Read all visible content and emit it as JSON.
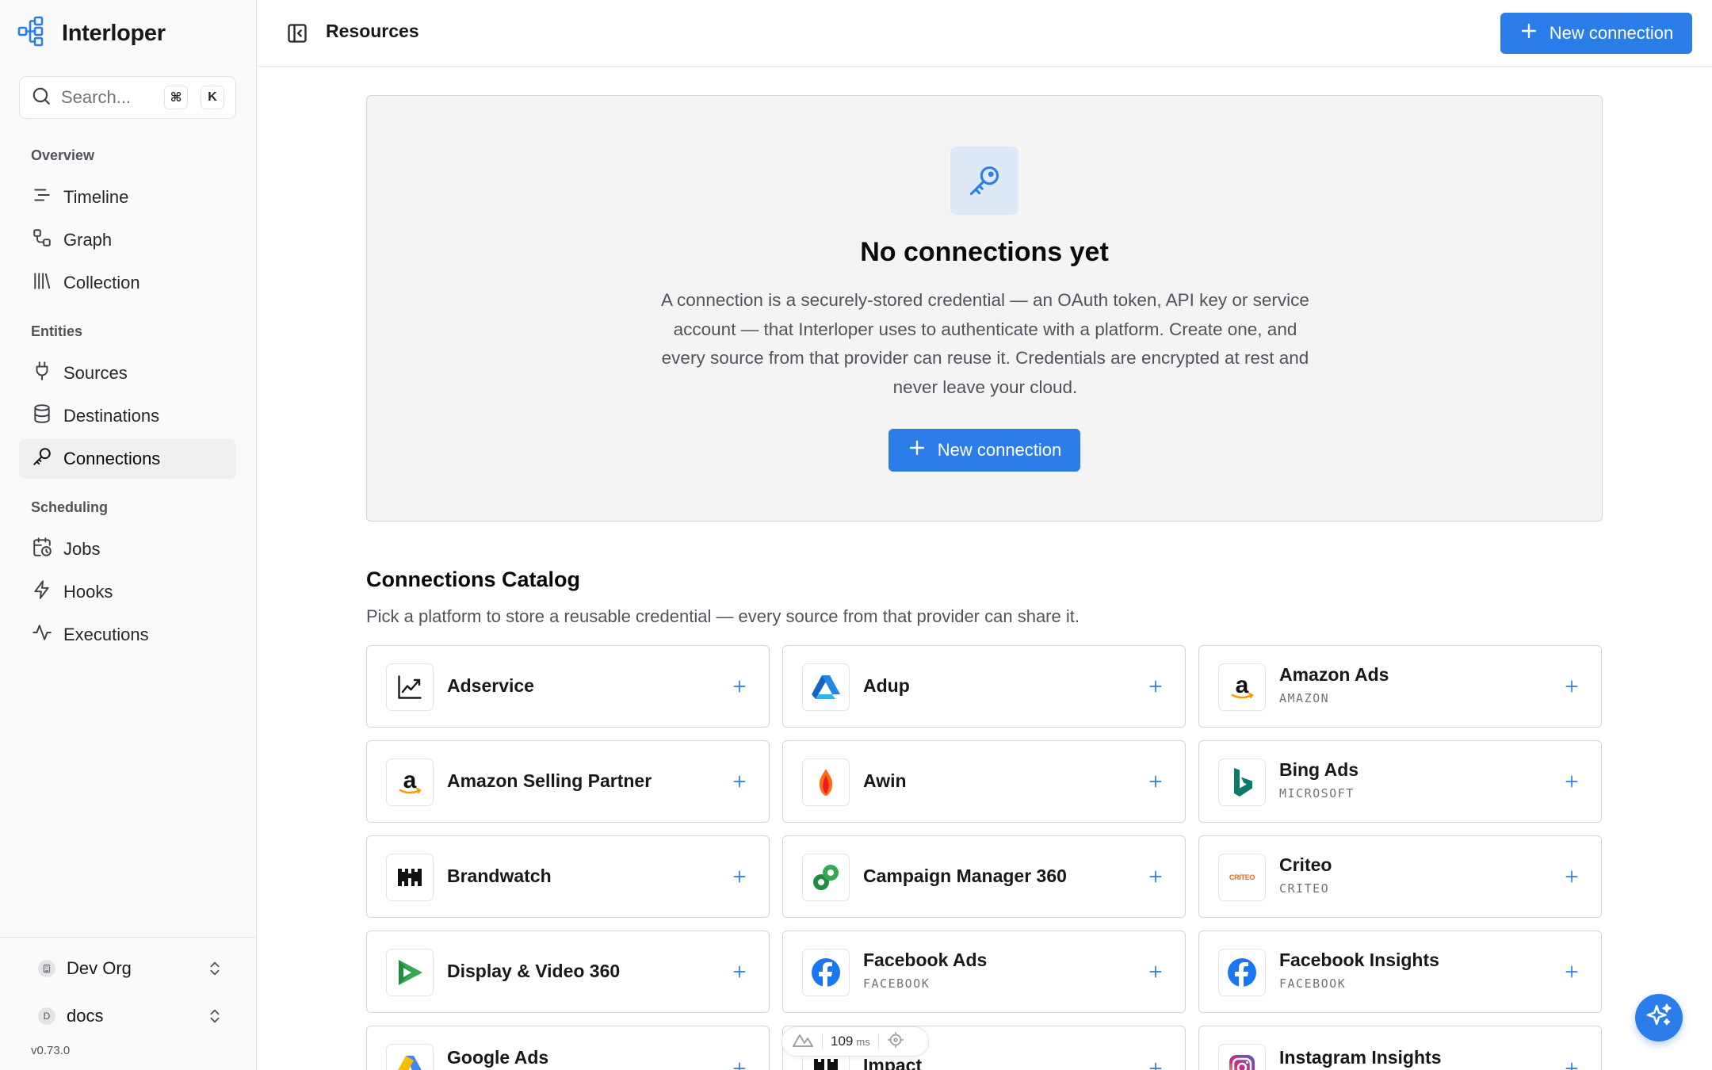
{
  "app": {
    "name": "Interloper",
    "version": "v0.73.0"
  },
  "search": {
    "placeholder": "Search...",
    "shortcut_mod": "⌘",
    "shortcut_key": "K"
  },
  "sidebar": {
    "groups": [
      {
        "label": "Overview",
        "items": [
          {
            "label": "Timeline",
            "icon": "timeline-icon"
          },
          {
            "label": "Graph",
            "icon": "graph-icon"
          },
          {
            "label": "Collection",
            "icon": "library-icon"
          }
        ]
      },
      {
        "label": "Entities",
        "items": [
          {
            "label": "Sources",
            "icon": "plug-icon"
          },
          {
            "label": "Destinations",
            "icon": "database-icon"
          },
          {
            "label": "Connections",
            "icon": "key-icon",
            "active": true
          }
        ]
      },
      {
        "label": "Scheduling",
        "items": [
          {
            "label": "Jobs",
            "icon": "calendar-clock-icon"
          },
          {
            "label": "Hooks",
            "icon": "zap-icon"
          },
          {
            "label": "Executions",
            "icon": "activity-icon"
          }
        ]
      }
    ],
    "org": {
      "label": "Dev Org",
      "icon": "building-icon"
    },
    "environment": {
      "badge": "D",
      "label": "docs"
    }
  },
  "header": {
    "title": "Resources",
    "new_connection_label": "New connection"
  },
  "empty_state": {
    "title": "No connections yet",
    "description": "A connection is a securely-stored credential — an OAuth token, API key or service account — that Interloper uses to authenticate with a platform. Create one, and every source from that provider can reuse it. Credentials are encrypted at rest and never leave your cloud.",
    "button_label": "New connection"
  },
  "catalog": {
    "title": "Connections Catalog",
    "subtitle": "Pick a platform to store a reusable credential — every source from that provider can share it.",
    "items": [
      {
        "name": "Adservice",
        "provider": "",
        "logo": "adservice-logo"
      },
      {
        "name": "Adup",
        "provider": "",
        "logo": "adup-logo"
      },
      {
        "name": "Amazon Ads",
        "provider": "AMAZON",
        "logo": "amazon-logo"
      },
      {
        "name": "Amazon Selling Partner",
        "provider": "",
        "logo": "amazon-logo"
      },
      {
        "name": "Awin",
        "provider": "",
        "logo": "awin-logo"
      },
      {
        "name": "Bing Ads",
        "provider": "MICROSOFT",
        "logo": "bing-logo"
      },
      {
        "name": "Brandwatch",
        "provider": "",
        "logo": "brandwatch-logo"
      },
      {
        "name": "Campaign Manager 360",
        "provider": "",
        "logo": "campaign-manager-logo"
      },
      {
        "name": "Criteo",
        "provider": "CRITEO",
        "logo": "criteo-logo",
        "logo_text": "CRITEO"
      },
      {
        "name": "Display & Video 360",
        "provider": "",
        "logo": "dv360-logo"
      },
      {
        "name": "Facebook Ads",
        "provider": "FACEBOOK",
        "logo": "facebook-logo"
      },
      {
        "name": "Facebook Insights",
        "provider": "FACEBOOK",
        "logo": "facebook-logo"
      },
      {
        "name": "Google Ads",
        "provider": "",
        "logo": "google-ads-logo"
      },
      {
        "name": "Impact",
        "provider": "",
        "logo": "impact-logo"
      },
      {
        "name": "Instagram Insights",
        "provider": "",
        "logo": "instagram-logo"
      }
    ]
  },
  "perf": {
    "value": "109",
    "unit": "ms"
  },
  "colors": {
    "accent": "#2b7de9",
    "sidebar_bg": "#fafafa",
    "panel_bg": "#f4f4f5"
  }
}
